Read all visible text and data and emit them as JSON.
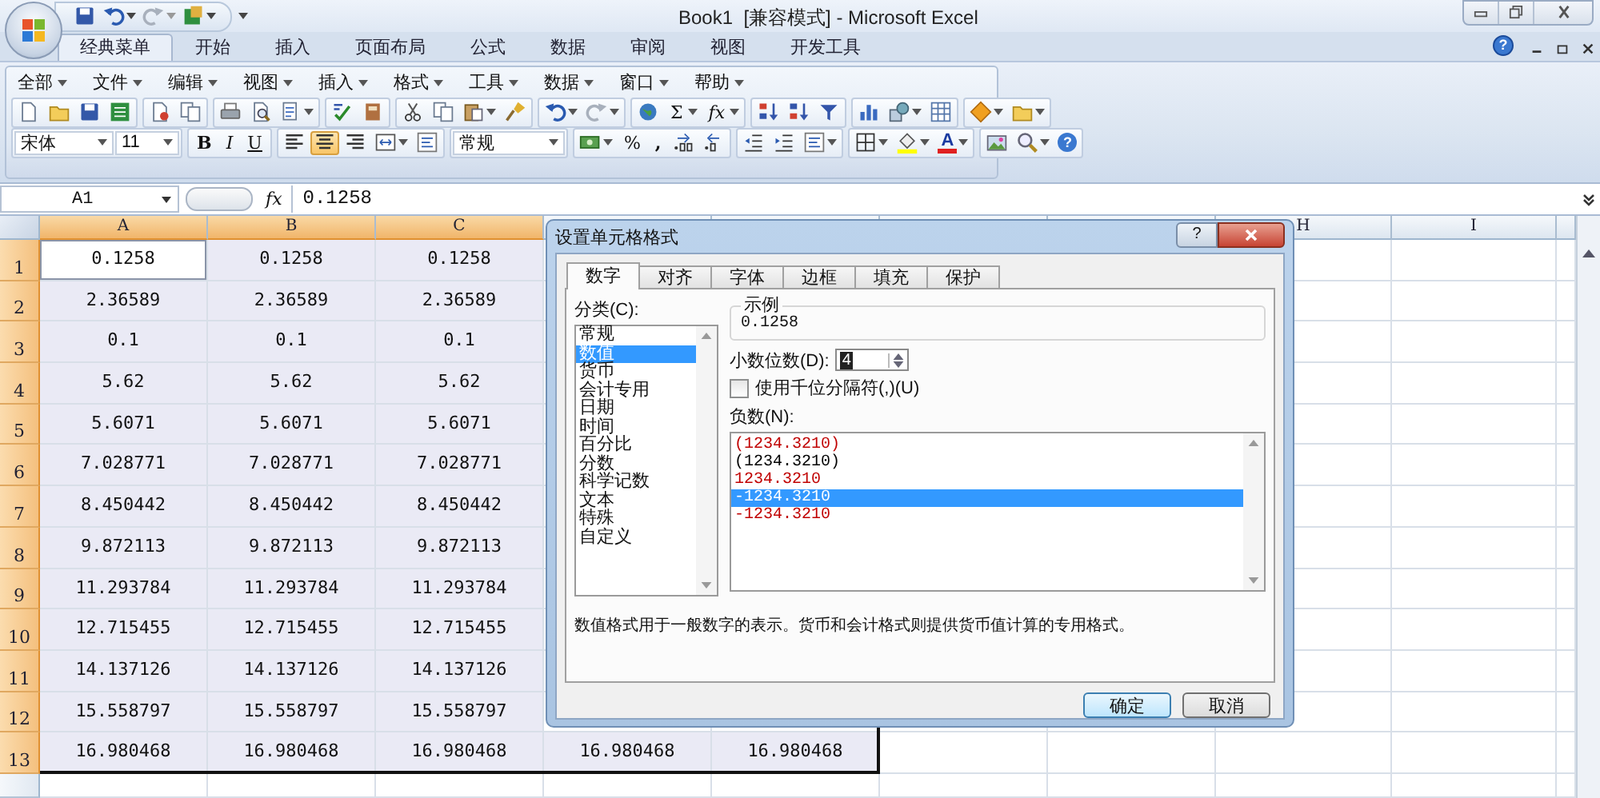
{
  "title_bar": {
    "title": "Book1  [兼容模式] - Microsoft Excel"
  },
  "ribbon": {
    "help": "?",
    "tabs": [
      {
        "label": "经典菜单",
        "selected": true
      },
      {
        "label": "开始",
        "selected": false
      },
      {
        "label": "插入",
        "selected": false
      },
      {
        "label": "页面布局",
        "selected": false
      },
      {
        "label": "公式",
        "selected": false
      },
      {
        "label": "数据",
        "selected": false
      },
      {
        "label": "审阅",
        "selected": false
      },
      {
        "label": "视图",
        "selected": false
      },
      {
        "label": "开发工具",
        "selected": false
      }
    ]
  },
  "classic_menu": [
    "全部",
    "文件",
    "编辑",
    "视图",
    "插入",
    "格式",
    "工具",
    "数据",
    "窗口",
    "帮助"
  ],
  "toolbar": {
    "font": "宋体",
    "font_size": "11",
    "bold": "B",
    "italic": "I",
    "underline": "U",
    "number_format": "常规",
    "sum": "Σ",
    "function": "fx",
    "percent": "%",
    "comma": ",",
    "font_color": "A",
    "help": "?",
    "alignment": {
      "left": false,
      "center": true,
      "right": false
    }
  },
  "formula_bar": {
    "name_box": "A1",
    "fx": "fx",
    "value": "0.1258"
  },
  "sheet": {
    "columns_left": [
      {
        "label": "A",
        "selected": true
      },
      {
        "label": "B",
        "selected": true
      },
      {
        "label": "C",
        "selected": true
      }
    ],
    "columns_right": [
      {
        "label": "H",
        "selected": false
      },
      {
        "label": "I",
        "selected": false
      }
    ],
    "rows": [
      {
        "number": "1",
        "selected": true,
        "cells": [
          {
            "value": "0.1258",
            "selected": true,
            "active": true
          },
          {
            "value": "0.1258",
            "selected": true,
            "active": false
          },
          {
            "value": "0.1258",
            "selected": true,
            "active": false
          }
        ]
      },
      {
        "number": "2",
        "selected": true,
        "cells": [
          {
            "value": "2.36589",
            "selected": true,
            "active": false
          },
          {
            "value": "2.36589",
            "selected": true,
            "active": false
          },
          {
            "value": "2.36589",
            "selected": true,
            "active": false
          }
        ]
      },
      {
        "number": "3",
        "selected": true,
        "cells": [
          {
            "value": "0.1",
            "selected": true,
            "active": false
          },
          {
            "value": "0.1",
            "selected": true,
            "active": false
          },
          {
            "value": "0.1",
            "selected": true,
            "active": false
          }
        ]
      },
      {
        "number": "4",
        "selected": true,
        "cells": [
          {
            "value": "5.62",
            "selected": true,
            "active": false
          },
          {
            "value": "5.62",
            "selected": true,
            "active": false
          },
          {
            "value": "5.62",
            "selected": true,
            "active": false
          }
        ]
      },
      {
        "number": "5",
        "selected": true,
        "cells": [
          {
            "value": "5.6071",
            "selected": true,
            "active": false
          },
          {
            "value": "5.6071",
            "selected": true,
            "active": false
          },
          {
            "value": "5.6071",
            "selected": true,
            "active": false
          }
        ]
      },
      {
        "number": "6",
        "selected": true,
        "cells": [
          {
            "value": "7.028771",
            "selected": true,
            "active": false
          },
          {
            "value": "7.028771",
            "selected": true,
            "active": false
          },
          {
            "value": "7.028771",
            "selected": true,
            "active": false
          }
        ]
      },
      {
        "number": "7",
        "selected": true,
        "cells": [
          {
            "value": "8.450442",
            "selected": true,
            "active": false
          },
          {
            "value": "8.450442",
            "selected": true,
            "active": false
          },
          {
            "value": "8.450442",
            "selected": true,
            "active": false
          }
        ]
      },
      {
        "number": "8",
        "selected": true,
        "cells": [
          {
            "value": "9.872113",
            "selected": true,
            "active": false
          },
          {
            "value": "9.872113",
            "selected": true,
            "active": false
          },
          {
            "value": "9.872113",
            "selected": true,
            "active": false
          }
        ]
      },
      {
        "number": "9",
        "selected": true,
        "cells": [
          {
            "value": "11.293784",
            "selected": true,
            "active": false
          },
          {
            "value": "11.293784",
            "selected": true,
            "active": false
          },
          {
            "value": "11.293784",
            "selected": true,
            "active": false
          }
        ]
      },
      {
        "number": "10",
        "selected": true,
        "cells": [
          {
            "value": "12.715455",
            "selected": true,
            "active": false
          },
          {
            "value": "12.715455",
            "selected": true,
            "active": false
          },
          {
            "value": "12.715455",
            "selected": true,
            "active": false
          }
        ]
      },
      {
        "number": "11",
        "selected": true,
        "cells": [
          {
            "value": "14.137126",
            "selected": true,
            "active": false
          },
          {
            "value": "14.137126",
            "selected": true,
            "active": false
          },
          {
            "value": "14.137126",
            "selected": true,
            "active": false
          }
        ]
      },
      {
        "number": "12",
        "selected": true,
        "cells": [
          {
            "value": "15.558797",
            "selected": true,
            "active": false
          },
          {
            "value": "15.558797",
            "selected": true,
            "active": false
          },
          {
            "value": "15.558797",
            "selected": true,
            "active": false
          }
        ]
      },
      {
        "number": "13",
        "selected": true,
        "cells": [
          {
            "value": "16.980468",
            "selected": true,
            "active": false
          },
          {
            "value": "16.980468",
            "selected": true,
            "active": false
          },
          {
            "value": "16.980468",
            "selected": true,
            "active": false
          },
          {
            "value": "16.980468",
            "selected": true,
            "active": false
          },
          {
            "value": "16.980468",
            "selected": true,
            "active": false
          }
        ]
      }
    ]
  },
  "dialog": {
    "title": "设置单元格格式",
    "help": "?",
    "tabs": [
      {
        "label": "数字",
        "selected": true
      },
      {
        "label": "对齐",
        "selected": false
      },
      {
        "label": "字体",
        "selected": false
      },
      {
        "label": "边框",
        "selected": false
      },
      {
        "label": "填充",
        "selected": false
      },
      {
        "label": "保护",
        "selected": false
      }
    ],
    "category_label": "分类(C):",
    "categories": [
      {
        "label": "常规",
        "selected": false
      },
      {
        "label": "数值",
        "selected": true
      },
      {
        "label": "货币",
        "selected": false
      },
      {
        "label": "会计专用",
        "selected": false
      },
      {
        "label": "日期",
        "selected": false
      },
      {
        "label": "时间",
        "selected": false
      },
      {
        "label": "百分比",
        "selected": false
      },
      {
        "label": "分数",
        "selected": false
      },
      {
        "label": "科学记数",
        "selected": false
      },
      {
        "label": "文本",
        "selected": false
      },
      {
        "label": "特殊",
        "selected": false
      },
      {
        "label": "自定义",
        "selected": false
      }
    ],
    "sample_label": "示例",
    "sample_value": "0.1258",
    "decimal_label": "小数位数(D):",
    "decimal_value": "4",
    "thousands": {
      "label": "使用千位分隔符(,)(U)",
      "checked": false
    },
    "negative_label": "负数(N):",
    "negative_formats": [
      {
        "label": "(1234.3210)",
        "color": "#c00000",
        "selected": false
      },
      {
        "label": "(1234.3210)",
        "color": "#000000",
        "selected": false
      },
      {
        "label": "1234.3210",
        "color": "#c00000",
        "selected": false
      },
      {
        "label": "-1234.3210",
        "selected": true
      },
      {
        "label": "-1234.3210",
        "color": "#c00000",
        "selected": false
      }
    ],
    "description": "数值格式用于一般数字的表示。货币和会计格式则提供货币值计算的专用格式。",
    "buttons": [
      "确定",
      "取消"
    ]
  }
}
